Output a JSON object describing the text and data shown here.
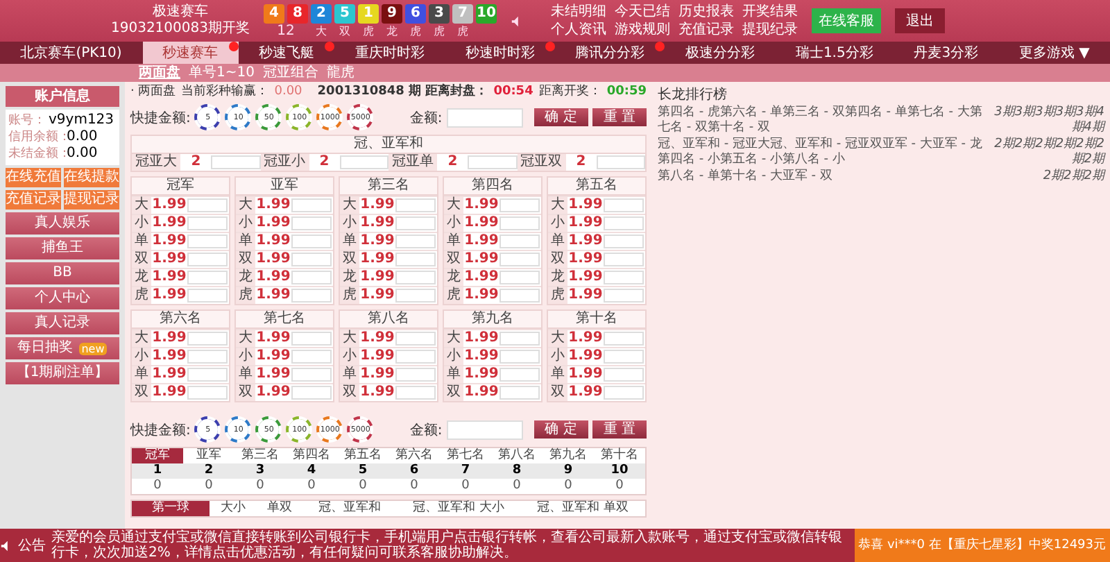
{
  "header": {
    "lottery_name": "极速赛车",
    "draw_issue": "19032100083期开奖",
    "balls": [
      {
        "number": "4",
        "color": "#f07a1a"
      },
      {
        "number": "8",
        "color": "#e8262a"
      },
      {
        "number": "2",
        "color": "#1f86d8"
      },
      {
        "number": "5",
        "color": "#2cc6d0"
      },
      {
        "number": "1",
        "color": "#e6d820"
      },
      {
        "number": "9",
        "color": "#7a1010"
      },
      {
        "number": "6",
        "color": "#4050e0"
      },
      {
        "number": "3",
        "color": "#4a4a4a"
      },
      {
        "number": "7",
        "color": "#c0c0c0"
      },
      {
        "number": "10",
        "color": "#2aa82a"
      }
    ],
    "ball_results": [
      "12",
      "大",
      "双",
      "虎",
      "龙",
      "虎",
      "虎",
      "虎"
    ],
    "links": [
      "未结明细",
      "今天已结",
      "历史报表",
      "开奖结果",
      "个人资讯",
      "游戏规则",
      "充值记录",
      "提现纪录"
    ],
    "service_button": "在线客服",
    "logout_button": "退出"
  },
  "nav_tabs": [
    {
      "label": "北京赛车(PK10)",
      "selected": false,
      "hot": false
    },
    {
      "label": "秒速赛车",
      "selected": true,
      "hot": true
    },
    {
      "label": "秒速飞艇",
      "selected": false,
      "hot": true
    },
    {
      "label": "重庆时时彩",
      "selected": false,
      "hot": false
    },
    {
      "label": "秒速时时彩",
      "selected": false,
      "hot": true
    },
    {
      "label": "腾讯分分彩",
      "selected": false,
      "hot": true
    },
    {
      "label": "极速分分彩",
      "selected": false,
      "hot": false
    },
    {
      "label": "瑞士1.5分彩",
      "selected": false,
      "hot": false
    },
    {
      "label": "丹麦3分彩",
      "selected": false,
      "hot": false
    },
    {
      "label": "更多游戏 ▼",
      "selected": false,
      "hot": false
    }
  ],
  "sub_tabs": [
    {
      "label": "两面盘",
      "selected": true
    },
    {
      "label": "单号1~10",
      "selected": false
    },
    {
      "label": "冠亚组合",
      "selected": false
    },
    {
      "label": "龍虎",
      "selected": false
    }
  ],
  "sidebar": {
    "title": "账户信息",
    "account": [
      {
        "label": "账号：",
        "value": "v9ym123"
      },
      {
        "label": "信用余额：",
        "value": "0.00"
      },
      {
        "label": "未结金额：",
        "value": "0.00"
      }
    ],
    "quick_buttons": [
      "在线充值",
      "在线提款",
      "充值记录",
      "提现记录"
    ],
    "menu": [
      {
        "label": "真人娱乐"
      },
      {
        "label": "捕鱼王"
      },
      {
        "label": "BB"
      },
      {
        "label": "个人中心"
      },
      {
        "label": "真人记录"
      },
      {
        "label": "每日抽奖",
        "badge": "new"
      },
      {
        "label": "【1期刷注单】"
      }
    ]
  },
  "bet_panel": {
    "play_name": "· 两面盘",
    "profit_label": "当前彩种输赢：",
    "profit": "0.00",
    "issue_text": "2001310848 期 距离封盘：",
    "close_time": "00:54",
    "draw_label": "距离开奖：",
    "draw_time": "00:59",
    "quick_bet_top": {
      "label": "快捷金额:",
      "chips": [
        {
          "amount": "5",
          "color": "#3b3fae"
        },
        {
          "amount": "10",
          "color": "#2d7ac8"
        },
        {
          "amount": "50",
          "color": "#3a9a3a"
        },
        {
          "amount": "100",
          "color": "#8ab52a"
        },
        {
          "amount": "1000",
          "color": "#e8781e"
        },
        {
          "amount": "5000",
          "color": "#c0344a"
        }
      ],
      "amount_label": "金额:",
      "confirm": "确 定",
      "reset": "重 置"
    },
    "sum_section": {
      "title": "冠、亚军和",
      "items": [
        {
          "label": "冠亚大",
          "odds": "2"
        },
        {
          "label": "冠亚小",
          "odds": "2"
        },
        {
          "label": "冠亚单",
          "odds": "2"
        },
        {
          "label": "冠亚双",
          "odds": "2"
        }
      ]
    },
    "groups": [
      {
        "title": "冠军",
        "rows": [
          {
            "label": "大",
            "odds": "1.99"
          },
          {
            "label": "小",
            "odds": "1.99"
          },
          {
            "label": "单",
            "odds": "1.99"
          },
          {
            "label": "双",
            "odds": "1.99"
          },
          {
            "label": "龙",
            "odds": "1.99"
          },
          {
            "label": "虎",
            "odds": "1.99"
          }
        ]
      },
      {
        "title": "亚军",
        "rows": [
          {
            "label": "大",
            "odds": "1.99"
          },
          {
            "label": "小",
            "odds": "1.99"
          },
          {
            "label": "单",
            "odds": "1.99"
          },
          {
            "label": "双",
            "odds": "1.99"
          },
          {
            "label": "龙",
            "odds": "1.99"
          },
          {
            "label": "虎",
            "odds": "1.99"
          }
        ]
      },
      {
        "title": "第三名",
        "rows": [
          {
            "label": "大",
            "odds": "1.99"
          },
          {
            "label": "小",
            "odds": "1.99"
          },
          {
            "label": "单",
            "odds": "1.99"
          },
          {
            "label": "双",
            "odds": "1.99"
          },
          {
            "label": "龙",
            "odds": "1.99"
          },
          {
            "label": "虎",
            "odds": "1.99"
          }
        ]
      },
      {
        "title": "第四名",
        "rows": [
          {
            "label": "大",
            "odds": "1.99"
          },
          {
            "label": "小",
            "odds": "1.99"
          },
          {
            "label": "单",
            "odds": "1.99"
          },
          {
            "label": "双",
            "odds": "1.99"
          },
          {
            "label": "龙",
            "odds": "1.99"
          },
          {
            "label": "虎",
            "odds": "1.99"
          }
        ]
      },
      {
        "title": "第五名",
        "rows": [
          {
            "label": "大",
            "odds": "1.99"
          },
          {
            "label": "小",
            "odds": "1.99"
          },
          {
            "label": "单",
            "odds": "1.99"
          },
          {
            "label": "双",
            "odds": "1.99"
          },
          {
            "label": "龙",
            "odds": "1.99"
          },
          {
            "label": "虎",
            "odds": "1.99"
          }
        ]
      },
      {
        "title": "第六名",
        "rows": [
          {
            "label": "大",
            "odds": "1.99"
          },
          {
            "label": "小",
            "odds": "1.99"
          },
          {
            "label": "单",
            "odds": "1.99"
          },
          {
            "label": "双",
            "odds": "1.99"
          }
        ]
      },
      {
        "title": "第七名",
        "rows": [
          {
            "label": "大",
            "odds": "1.99"
          },
          {
            "label": "小",
            "odds": "1.99"
          },
          {
            "label": "单",
            "odds": "1.99"
          },
          {
            "label": "双",
            "odds": "1.99"
          }
        ]
      },
      {
        "title": "第八名",
        "rows": [
          {
            "label": "大",
            "odds": "1.99"
          },
          {
            "label": "小",
            "odds": "1.99"
          },
          {
            "label": "单",
            "odds": "1.99"
          },
          {
            "label": "双",
            "odds": "1.99"
          }
        ]
      },
      {
        "title": "第九名",
        "rows": [
          {
            "label": "大",
            "odds": "1.99"
          },
          {
            "label": "小",
            "odds": "1.99"
          },
          {
            "label": "单",
            "odds": "1.99"
          },
          {
            "label": "双",
            "odds": "1.99"
          }
        ]
      },
      {
        "title": "第十名",
        "rows": [
          {
            "label": "大",
            "odds": "1.99"
          },
          {
            "label": "小",
            "odds": "1.99"
          },
          {
            "label": "单",
            "odds": "1.99"
          },
          {
            "label": "双",
            "odds": "1.99"
          }
        ]
      }
    ],
    "quick_bet_bottom": {
      "label": "快捷金额:",
      "chips": [
        {
          "amount": "5",
          "color": "#3b3fae"
        },
        {
          "amount": "10",
          "color": "#2d7ac8"
        },
        {
          "amount": "50",
          "color": "#3a9a3a"
        },
        {
          "amount": "100",
          "color": "#8ab52a"
        },
        {
          "amount": "1000",
          "color": "#e8781e"
        },
        {
          "amount": "5000",
          "color": "#c0344a"
        }
      ],
      "amount_label": "金额:",
      "confirm": "确 定",
      "reset": "重 置"
    },
    "results": {
      "columns": [
        {
          "label": "冠军",
          "selected": true
        },
        {
          "label": "亚军",
          "selected": false
        },
        {
          "label": "第三名",
          "selected": false
        },
        {
          "label": "第四名",
          "selected": false
        },
        {
          "label": "第五名",
          "selected": false
        },
        {
          "label": "第六名",
          "selected": false
        },
        {
          "label": "第七名",
          "selected": false
        },
        {
          "label": "第八名",
          "selected": false
        },
        {
          "label": "第九名",
          "selected": false
        },
        {
          "label": "第十名",
          "selected": false
        }
      ],
      "numbers": [
        "1",
        "2",
        "3",
        "4",
        "5",
        "6",
        "7",
        "8",
        "9",
        "10"
      ],
      "counts": [
        "0",
        "0",
        "0",
        "0",
        "0",
        "0",
        "0",
        "0",
        "0",
        "0"
      ],
      "stat_tabs": [
        {
          "label": "第一球",
          "selected": true
        },
        {
          "label": "大小",
          "selected": false
        },
        {
          "label": "单双",
          "selected": false
        },
        {
          "label": "冠、亚军和",
          "selected": false
        },
        {
          "label": "冠、亚军和 大小",
          "selected": false
        },
        {
          "label": "冠、亚军和 单双",
          "selected": false
        }
      ]
    }
  },
  "dragon_ranking": {
    "title": "长龙排行榜",
    "lines": [
      {
        "text": "第四名 - 虎第六名 - 单第三名 - 双第四名 - 单第七名 - 大第七名 - 双第十名 - 双",
        "count": "3期3期3期3期3期4期4期"
      },
      {
        "text": "冠、亚军和 - 冠亚大冠、亚军和 - 冠亚双亚军 - 大亚军 - 龙第四名 - 小第五名 - 小第八名 - 小",
        "count": "2期2期2期2期2期2期2期"
      },
      {
        "text": "第八名 - 单第十名 - 大亚军 - 双",
        "count": "2期2期2期"
      }
    ]
  },
  "footer": {
    "notice_label": "公告",
    "notice": "亲爱的会员通过支付宝或微信直接转账到公司银行卡，手机端用户点击银行转帐，查看公司最新入款账号，通过支付宝或微信转银行卡，次次加送2%，详情点击优惠活动，有任何疑问可联系客服协助解决。",
    "winner": "恭喜 vi***0 在【重庆七星彩】中奖12493元"
  }
}
